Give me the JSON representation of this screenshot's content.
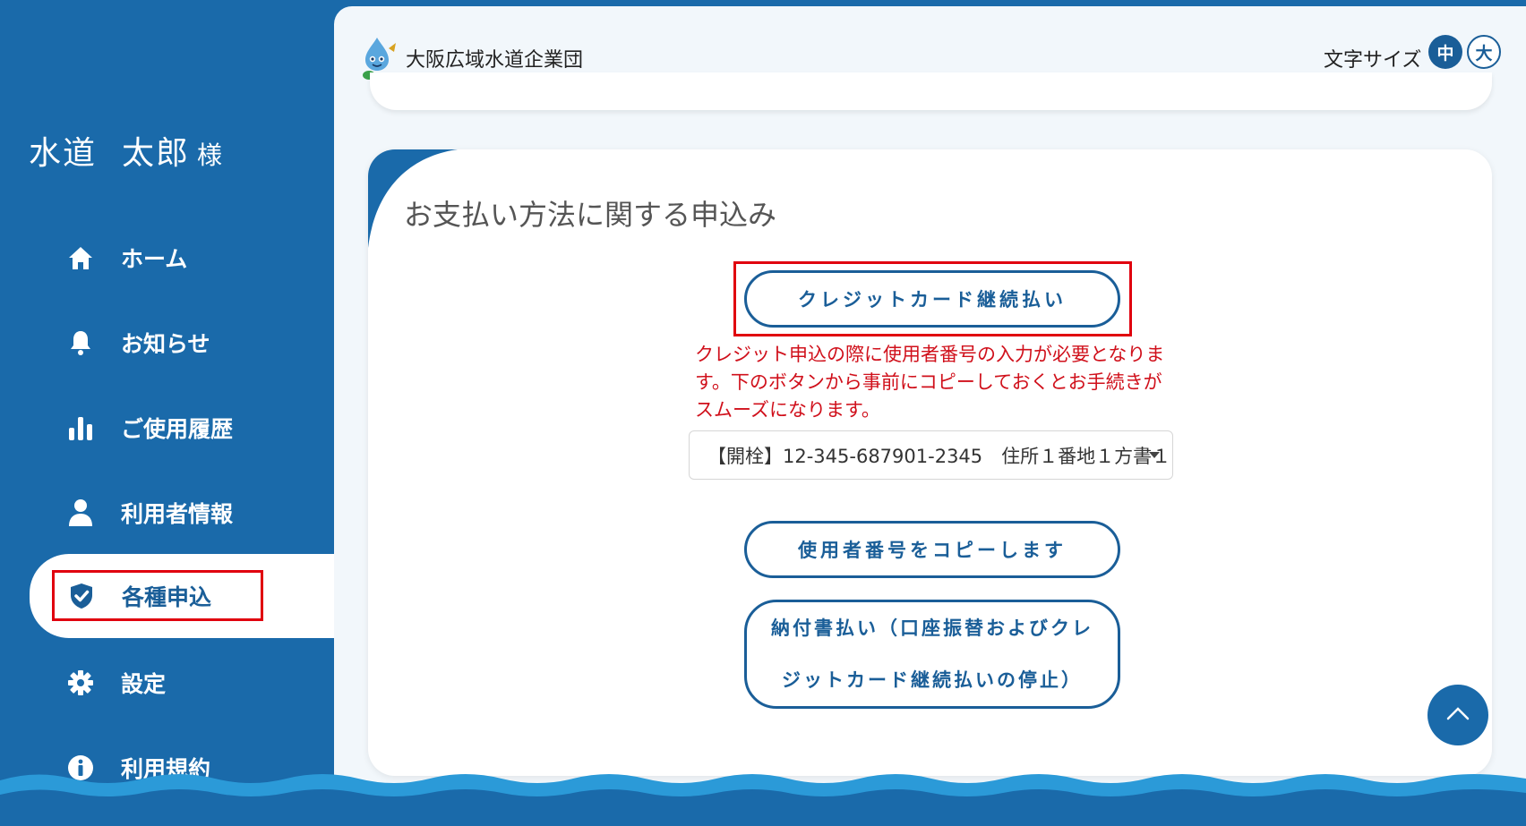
{
  "user": {
    "last_name": "水道",
    "first_name": "太郎",
    "honorific": "様"
  },
  "sidebar": {
    "items": [
      {
        "label": "ホーム",
        "icon": "home-icon"
      },
      {
        "label": "お知らせ",
        "icon": "bell-icon"
      },
      {
        "label": "ご使用履歴",
        "icon": "bar-chart-icon"
      },
      {
        "label": "利用者情報",
        "icon": "person-icon"
      },
      {
        "label": "各種申込",
        "icon": "check-shield-icon",
        "active": true
      },
      {
        "label": "設定",
        "icon": "gear-icon"
      },
      {
        "label": "利用規約",
        "icon": "info-icon"
      }
    ]
  },
  "header": {
    "org_name": "大阪広域水道企業団",
    "font_size_label": "文字サイズ",
    "font_size_mid": "中",
    "font_size_large": "大"
  },
  "card": {
    "title": "お支払い方法に関する申込み",
    "credit_button": "クレジットカード継続払い",
    "notice": "クレジット申込の際に使用者番号の入力が必要となります。下のボタンから事前にコピーしておくとお手続きがスムーズになります。",
    "select_value": "【開栓】12-345-687901-2345　住所１番地１方書１",
    "copy_button": "使用者番号をコピーします",
    "invoice_button": "納付書払い（口座振替およびクレジットカード継続払いの停止）"
  },
  "colors": {
    "brand_blue": "#1a6aaa",
    "highlight_red": "#e0000e",
    "notice_red": "#d0101b"
  }
}
